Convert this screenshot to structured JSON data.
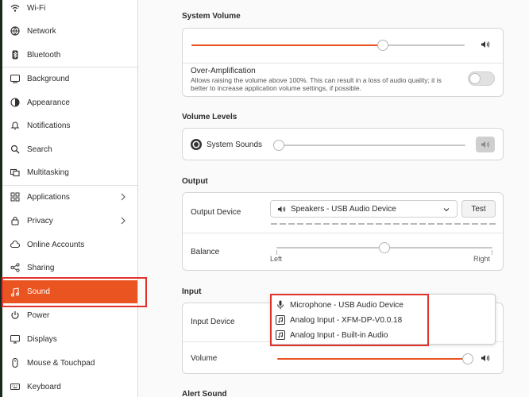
{
  "sidebar": {
    "items": [
      {
        "label": "Wi-Fi",
        "icon": "wifi-icon"
      },
      {
        "label": "Network",
        "icon": "network-icon"
      },
      {
        "label": "Bluetooth",
        "icon": "bluetooth-icon"
      },
      {
        "label": "Background",
        "icon": "background-icon"
      },
      {
        "label": "Appearance",
        "icon": "appearance-icon"
      },
      {
        "label": "Notifications",
        "icon": "bell-icon"
      },
      {
        "label": "Search",
        "icon": "search-icon"
      },
      {
        "label": "Multitasking",
        "icon": "multitasking-icon"
      },
      {
        "label": "Applications",
        "icon": "applications-icon"
      },
      {
        "label": "Privacy",
        "icon": "privacy-icon"
      },
      {
        "label": "Online Accounts",
        "icon": "cloud-icon"
      },
      {
        "label": "Sharing",
        "icon": "share-icon"
      },
      {
        "label": "Sound",
        "icon": "music-note-icon"
      },
      {
        "label": "Power",
        "icon": "power-icon"
      },
      {
        "label": "Displays",
        "icon": "display-icon"
      },
      {
        "label": "Mouse & Touchpad",
        "icon": "mouse-icon"
      },
      {
        "label": "Keyboard",
        "icon": "keyboard-icon"
      }
    ],
    "active": "Sound"
  },
  "system_volume": {
    "title": "System Volume",
    "level": 0.7,
    "over_amp_title": "Over-Amplification",
    "over_amp_desc": "Allows raising the volume above 100%. This can result in a loss of audio quality; it is better to increase application volume settings, if possible.",
    "over_amp_enabled": false
  },
  "volume_levels": {
    "title": "Volume Levels",
    "system_sounds_label": "System Sounds",
    "system_sounds_level": 0.0,
    "muted": true
  },
  "output": {
    "title": "Output",
    "device_label": "Output Device",
    "device_value": "Speakers - USB Audio Device",
    "test_label": "Test",
    "balance_label": "Balance",
    "balance_left": "Left",
    "balance_right": "Right",
    "balance_value": 0.5
  },
  "input": {
    "title": "Input",
    "device_label": "Input Device",
    "volume_label": "Volume",
    "volume_level": 0.99,
    "options": [
      {
        "label": "Microphone - USB Audio Device",
        "icon": "microphone-icon"
      },
      {
        "label": "Analog Input - XFM-DP-V0.0.18",
        "icon": "audio-file-icon"
      },
      {
        "label": "Analog Input - Built-in Audio",
        "icon": "audio-file-icon"
      }
    ]
  },
  "alert_sound": {
    "title": "Alert Sound"
  },
  "colors": {
    "accent": "#e95420",
    "highlight_box": "#e0332e"
  }
}
